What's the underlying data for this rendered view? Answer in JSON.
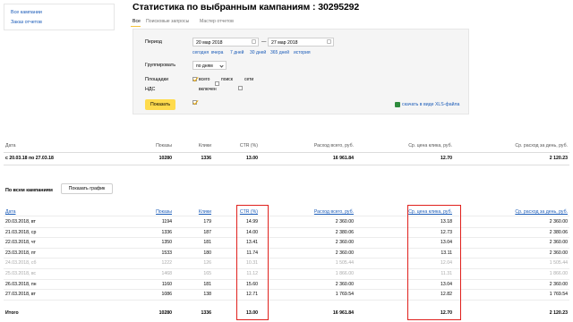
{
  "nav": {
    "all_campaigns": "Все кампании",
    "order_reports": "Заказ отчетов"
  },
  "page": {
    "title": "Статистика по выбранным кампаниям : 30295292"
  },
  "tabs": [
    {
      "label": "Все",
      "active": true
    },
    {
      "label": "Поисковые запросы",
      "active": false
    },
    {
      "label": "Мастер отчетов",
      "active": false
    }
  ],
  "filters": {
    "period_label": "Период",
    "date_from": "20 мар 2018",
    "dash": "—",
    "date_to": "27 мар 2018",
    "quick_links": [
      "сегодня",
      "вчера",
      "7 дней",
      "30 дней",
      "365 дней",
      "история"
    ],
    "group_label": "Группировать",
    "group_value": "по дням",
    "sites_label": "Площадки",
    "sites": [
      {
        "label": "всего",
        "checked": true
      },
      {
        "label": "поиск",
        "checked": false
      },
      {
        "label": "сети",
        "checked": false
      }
    ],
    "vat_label": "НДС",
    "vat_option": {
      "label": "включен",
      "checked": true
    },
    "show_button": "Показать",
    "xls_link": "скачать в виде XLS-файла"
  },
  "summary": {
    "headers": [
      "Дата",
      "Показы",
      "Клики",
      "CTR (%)",
      "Расход всего, руб.",
      "Ср. цена клика, руб.",
      "Ср. расход за день, руб."
    ],
    "row": [
      "с 20.03.18 по 27.03.18",
      "10280",
      "1336",
      "13.00",
      "16 961.84",
      "12.70",
      "2 120.23"
    ]
  },
  "by_campaigns": {
    "label": "По всем кампаниям",
    "graph_button": "Показать график"
  },
  "table": {
    "headers": [
      "Дата",
      "Показы",
      "Клики",
      "CTR (%)",
      "Расход всего, руб.",
      "Ср. цена клика, руб.",
      "Ср. расход за день, руб."
    ],
    "rows": [
      {
        "cells": [
          "20.03.2018, вт",
          "1194",
          "179",
          "14.99",
          "2 360.00",
          "13.18",
          "2 360.00"
        ],
        "weekend": false
      },
      {
        "cells": [
          "21.03.2018, ср",
          "1336",
          "187",
          "14.00",
          "2 380.06",
          "12.73",
          "2 380.06"
        ],
        "weekend": false
      },
      {
        "cells": [
          "22.03.2018, чт",
          "1350",
          "181",
          "13.41",
          "2 360.00",
          "13.04",
          "2 360.00"
        ],
        "weekend": false
      },
      {
        "cells": [
          "23.03.2018, пт",
          "1533",
          "180",
          "11.74",
          "2 360.00",
          "13.11",
          "2 360.00"
        ],
        "weekend": false
      },
      {
        "cells": [
          "24.03.2018, сб",
          "1222",
          "126",
          "10.31",
          "1 505.44",
          "12.04",
          "1 505.44"
        ],
        "weekend": true
      },
      {
        "cells": [
          "25.03.2018, вс",
          "1468",
          "165",
          "11.12",
          "1 866.00",
          "11.31",
          "1 866.00"
        ],
        "weekend": true
      },
      {
        "cells": [
          "26.03.2018, пн",
          "1160",
          "181",
          "15.60",
          "2 360.00",
          "13.04",
          "2 360.00"
        ],
        "weekend": false
      },
      {
        "cells": [
          "27.03.2018, вт",
          "1086",
          "138",
          "12.71",
          "1 769.54",
          "12.82",
          "1 769.54"
        ],
        "weekend": false
      }
    ],
    "total": [
      "Итого",
      "10280",
      "1336",
      "13.00",
      "16 961.84",
      "12.70",
      "2 120.23"
    ]
  },
  "colors": {
    "accent_yellow": "#ffdb4d",
    "link_blue": "#1a5bb8",
    "highlight_red": "#e0201c"
  }
}
